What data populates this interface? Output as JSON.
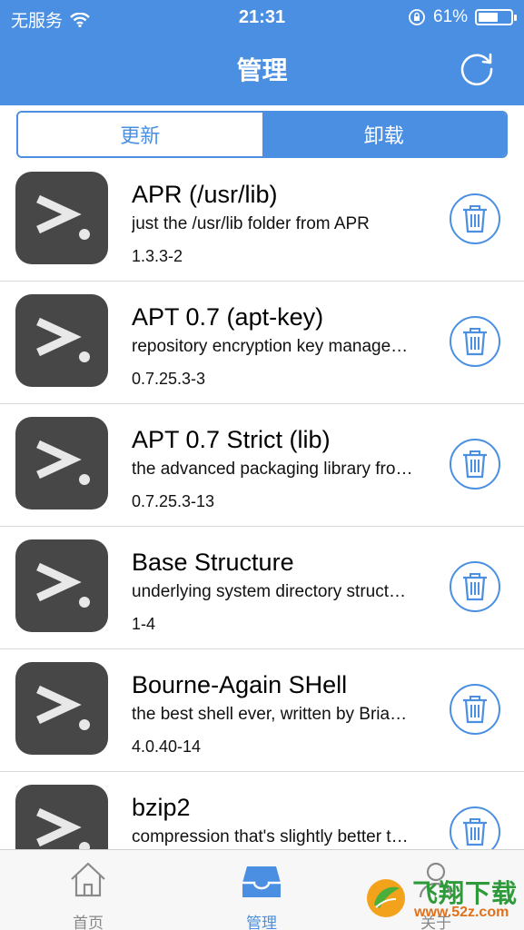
{
  "status": {
    "carrier": "无服务",
    "time": "21:31",
    "battery_text": "61%",
    "battery_level": 0.61
  },
  "nav": {
    "title": "管理",
    "refresh_icon": "refresh-icon"
  },
  "segment": {
    "items": [
      {
        "label": "更新",
        "selected": false
      },
      {
        "label": "卸载",
        "selected": true
      }
    ]
  },
  "packages": [
    {
      "name": "APR (/usr/lib)",
      "desc": "just the /usr/lib folder from APR",
      "version": "1.3.3-2"
    },
    {
      "name": "APT 0.7 (apt-key)",
      "desc": "repository encryption key manage…",
      "version": "0.7.25.3-3"
    },
    {
      "name": "APT 0.7 Strict (lib)",
      "desc": "the advanced packaging library fro…",
      "version": "0.7.25.3-13"
    },
    {
      "name": "Base Structure",
      "desc": "underlying system directory struct…",
      "version": "1-4"
    },
    {
      "name": "Bourne-Again SHell",
      "desc": "the best shell ever, written by Bria…",
      "version": "4.0.40-14"
    },
    {
      "name": "bzip2",
      "desc": "compression that's slightly better t…",
      "version": ""
    }
  ],
  "tabbar": {
    "tabs": [
      {
        "label": "首页",
        "icon": "home-icon",
        "active": false
      },
      {
        "label": "管理",
        "icon": "inbox-icon",
        "active": true
      },
      {
        "label": "关于",
        "icon": "person-icon",
        "active": false
      }
    ]
  },
  "watermark": {
    "text": "飞翔下载",
    "url": "www.52z.com"
  },
  "colors": {
    "accent": "#4a8fe2",
    "icon_bg": "#474747"
  }
}
